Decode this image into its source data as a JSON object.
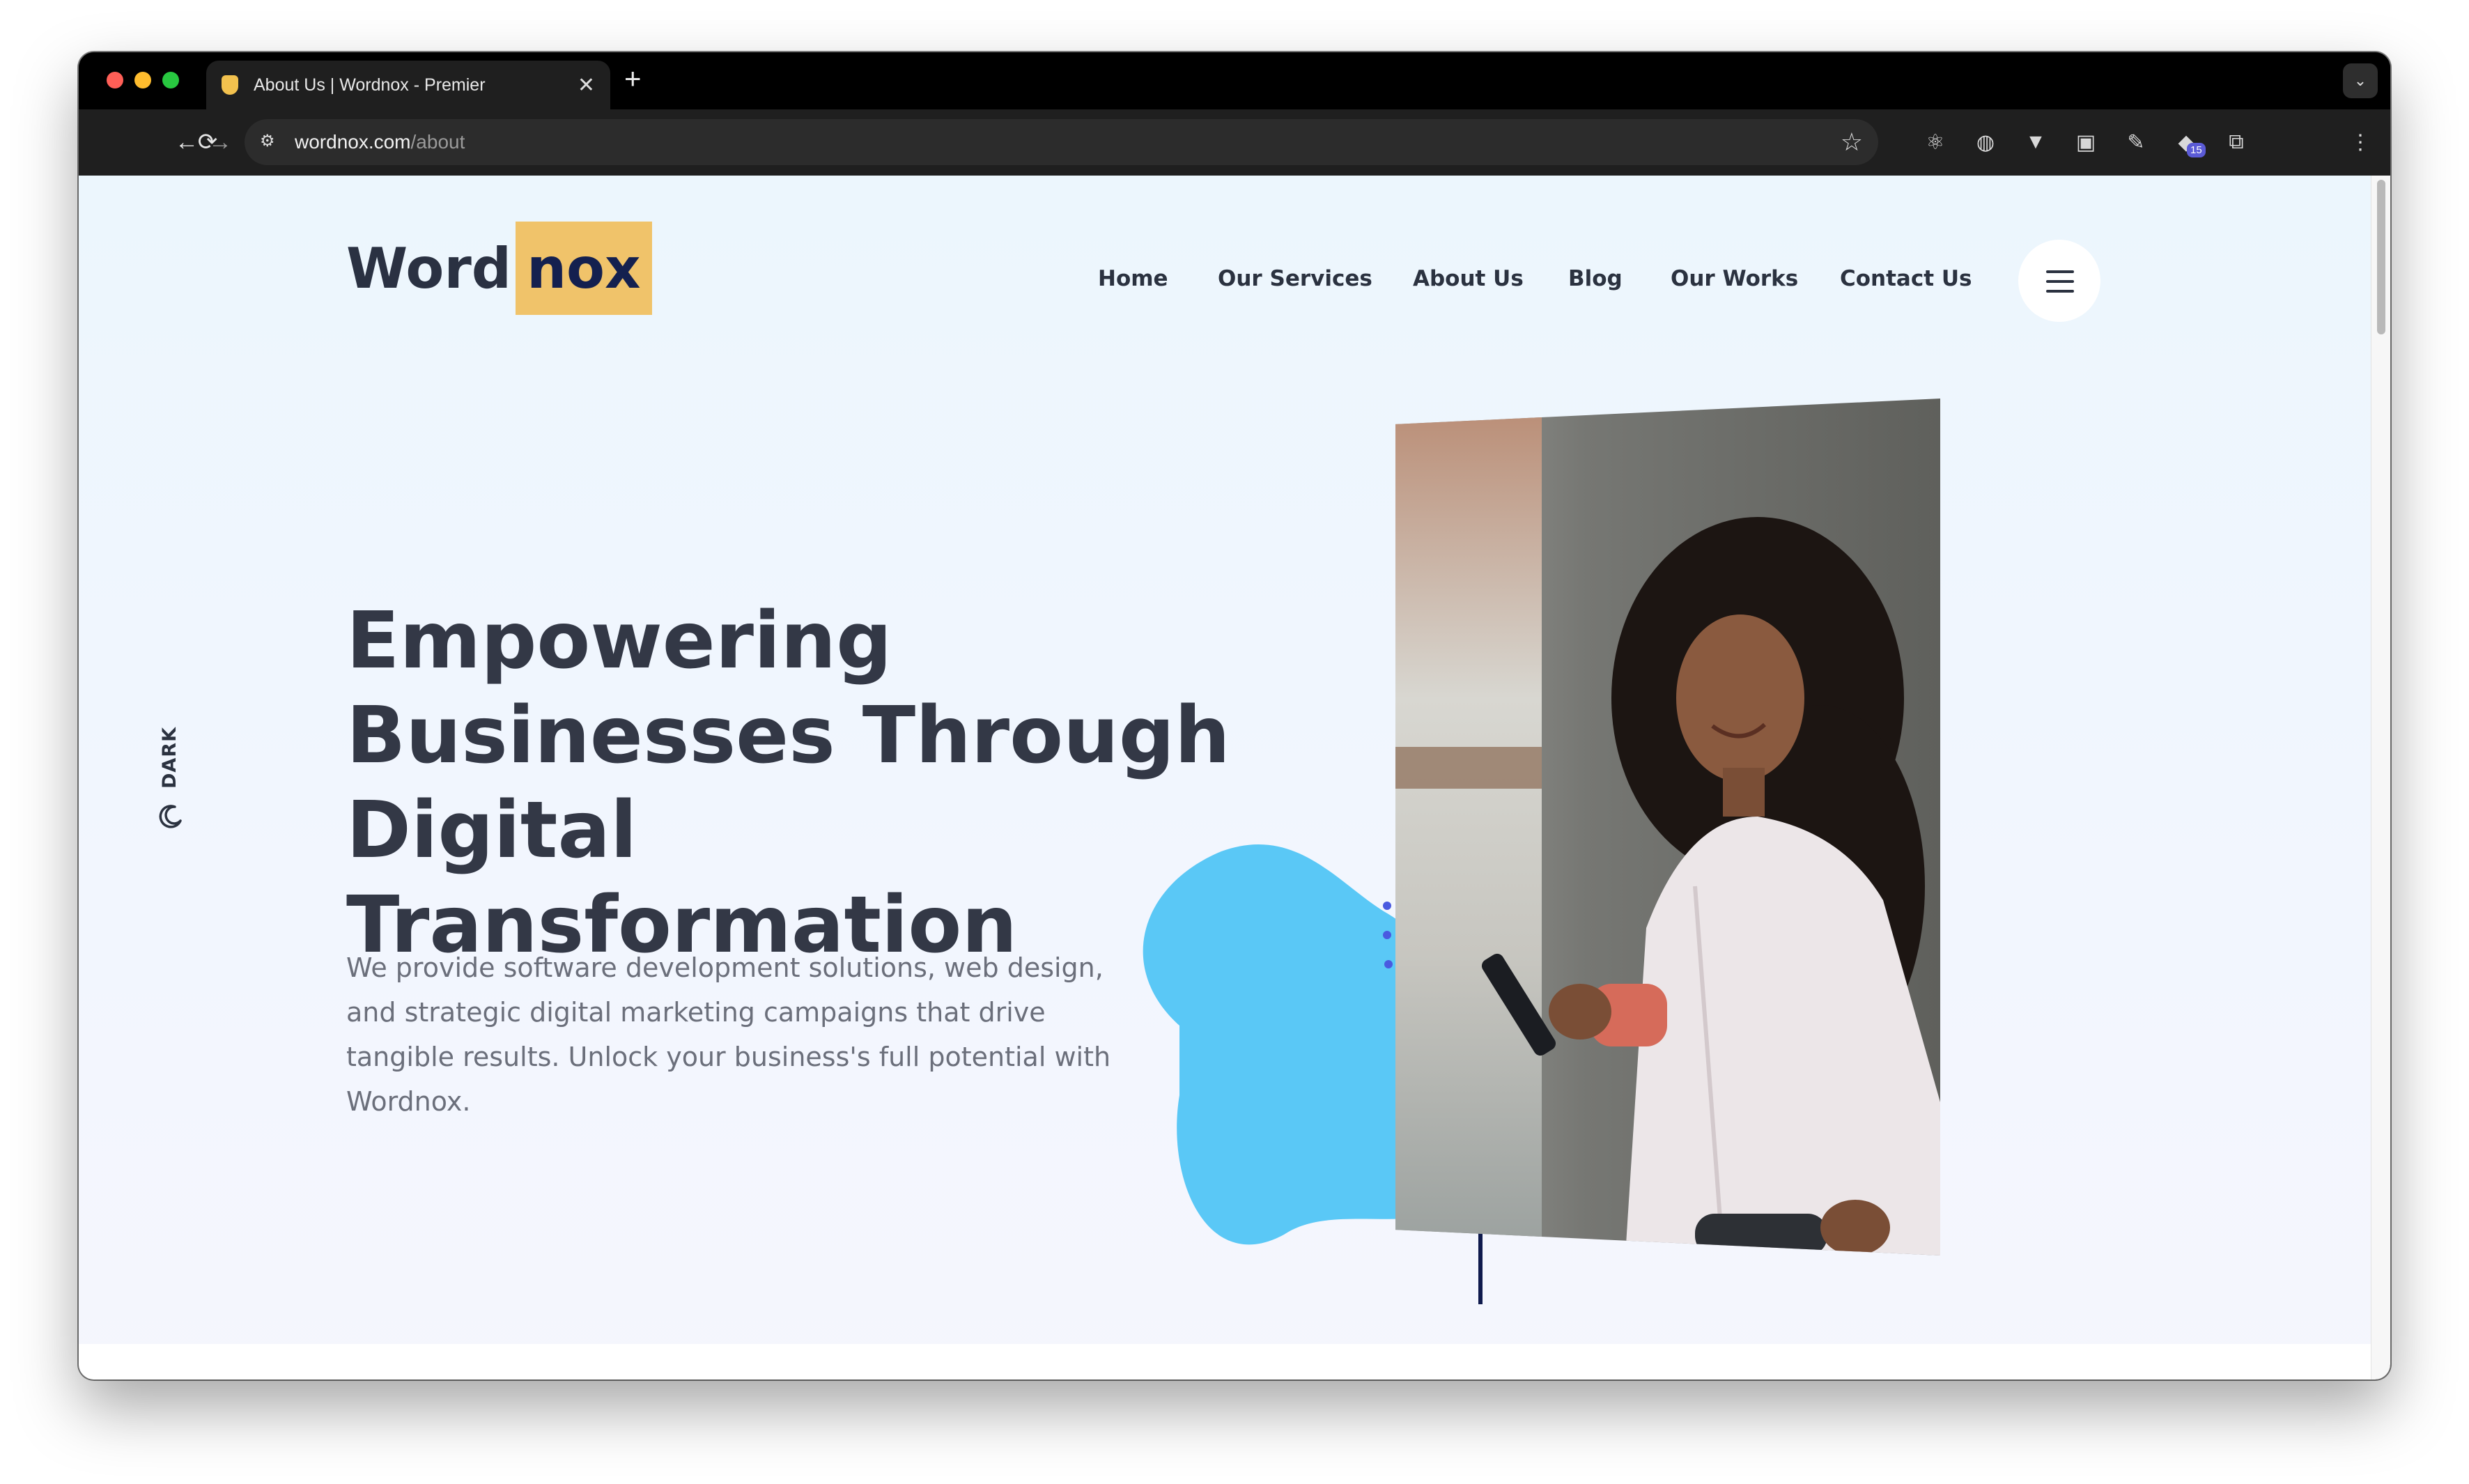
{
  "browser": {
    "tab_title": "About Us | Wordnox - Premier",
    "url_host": "wordnox.com",
    "url_path": "/about",
    "extension_badge": "15"
  },
  "site": {
    "logo_part1": "Word",
    "logo_part2": "nox",
    "nav": [
      "Home",
      "Our Services",
      "About Us",
      "Blog",
      "Our Works",
      "Contact Us"
    ],
    "dark_toggle_label": "DARK"
  },
  "hero": {
    "headline_lines": [
      "Empowering",
      "Businesses Through",
      "Digital Transformation"
    ],
    "paragraph_lines": [
      "We provide software development solutions, web design,",
      "and strategic digital marketing campaigns that drive",
      "tangible results. Unlock your business's full potential with",
      "Wordnox."
    ]
  },
  "colors": {
    "logo_highlight": "#f0c36a",
    "blob": "#5ac8f6",
    "dots": "#4a5ae0",
    "frame": "#0f1a4d"
  },
  "icons": [
    "search-icon",
    "star-icon",
    "moon-icon",
    "hamburger-icon"
  ]
}
